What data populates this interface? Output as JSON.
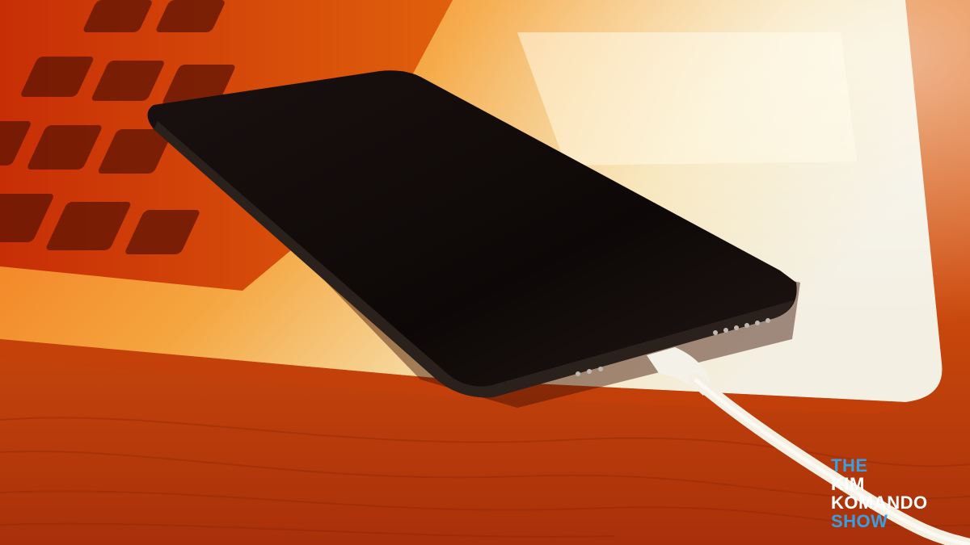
{
  "image": {
    "subject": "Black smartphone charging on a laptop with a white cable",
    "palette": {
      "background_warm": "#d9540c",
      "laptop_silver": "#f3e3b4",
      "phone_black": "#0d0908",
      "cable_white": "#f4f1e8",
      "logo_blue": "#3a9fe0",
      "logo_white": "#ffffff"
    }
  },
  "logo": {
    "line1": "THE",
    "line2": "KIM",
    "line3": "KOMANDO",
    "line4": "SHOW"
  }
}
